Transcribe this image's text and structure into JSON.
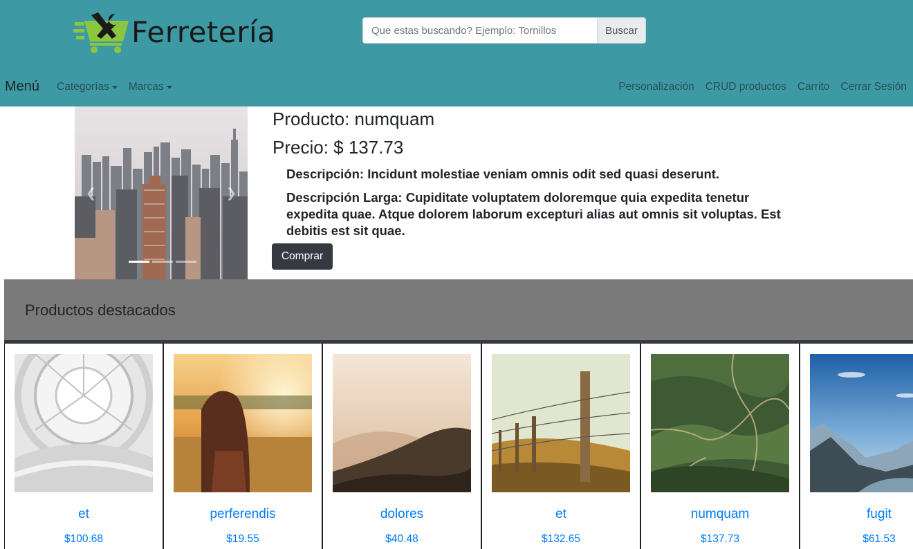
{
  "header": {
    "brand_name": "Ferretería",
    "logo_icon": "hardware-cart-logo",
    "search_placeholder": "Que estas buscando? Ejemplo: Tornillos",
    "search_button": "Buscar"
  },
  "nav": {
    "menu_label": "Menú",
    "left": [
      {
        "label": "Categorías"
      },
      {
        "label": "Marcas"
      }
    ],
    "right": [
      {
        "label": "Personalización"
      },
      {
        "label": "CRUD productos"
      },
      {
        "label": "Carrito"
      },
      {
        "label": "Cerrar Sesión"
      }
    ]
  },
  "product": {
    "title": "Producto: numquam",
    "price": "Precio: $ 137.73",
    "description": "Descripción: Incidunt molestiae veniam omnis odit sed quasi deserunt.",
    "long_description": "Descripción Larga: Cupiditate voluptatem doloremque quia expedita tenetur expedita quae. Atque dolorem laborum excepturi alias aut omnis sit voluptas. Est debitis est sit quae.",
    "buy_button": "Comprar",
    "carousel": {
      "image": "city-skyline-photo",
      "slides": 3,
      "active_slide": 1
    }
  },
  "featured": {
    "title": "Productos destacados",
    "items": [
      {
        "name": "et",
        "price": "$100.68",
        "image": "atrium-photo"
      },
      {
        "name": "perferendis",
        "price": "$19.55",
        "image": "sunset-girl-photo"
      },
      {
        "name": "dolores",
        "price": "$40.48",
        "image": "misty-hills-photo"
      },
      {
        "name": "et",
        "price": "$132.65",
        "image": "fence-photo"
      },
      {
        "name": "numquam",
        "price": "$137.73",
        "image": "aerial-valley-photo"
      },
      {
        "name": "fugit",
        "price": "$61.53",
        "image": "mountains-photo"
      }
    ]
  },
  "colors": {
    "header_bg": "#3d9aa4",
    "link": "#007bff",
    "dark_button": "#343a40",
    "featured_bg": "#7a7a7a"
  }
}
